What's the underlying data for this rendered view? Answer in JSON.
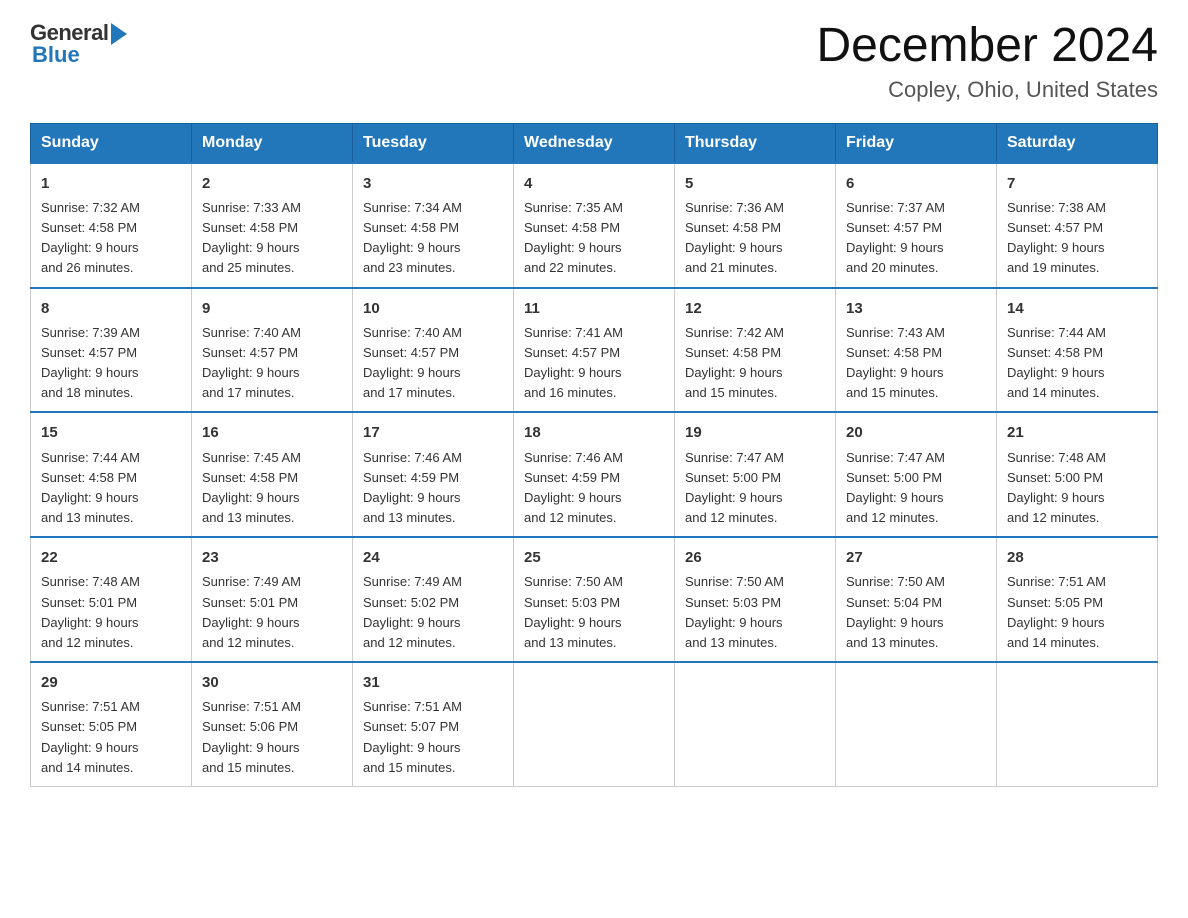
{
  "header": {
    "logo_general": "General",
    "logo_blue": "Blue",
    "title": "December 2024",
    "subtitle": "Copley, Ohio, United States"
  },
  "days_of_week": [
    "Sunday",
    "Monday",
    "Tuesday",
    "Wednesday",
    "Thursday",
    "Friday",
    "Saturday"
  ],
  "weeks": [
    [
      {
        "day": "1",
        "sunrise": "7:32 AM",
        "sunset": "4:58 PM",
        "daylight": "9 hours and 26 minutes."
      },
      {
        "day": "2",
        "sunrise": "7:33 AM",
        "sunset": "4:58 PM",
        "daylight": "9 hours and 25 minutes."
      },
      {
        "day": "3",
        "sunrise": "7:34 AM",
        "sunset": "4:58 PM",
        "daylight": "9 hours and 23 minutes."
      },
      {
        "day": "4",
        "sunrise": "7:35 AM",
        "sunset": "4:58 PM",
        "daylight": "9 hours and 22 minutes."
      },
      {
        "day": "5",
        "sunrise": "7:36 AM",
        "sunset": "4:58 PM",
        "daylight": "9 hours and 21 minutes."
      },
      {
        "day": "6",
        "sunrise": "7:37 AM",
        "sunset": "4:57 PM",
        "daylight": "9 hours and 20 minutes."
      },
      {
        "day": "7",
        "sunrise": "7:38 AM",
        "sunset": "4:57 PM",
        "daylight": "9 hours and 19 minutes."
      }
    ],
    [
      {
        "day": "8",
        "sunrise": "7:39 AM",
        "sunset": "4:57 PM",
        "daylight": "9 hours and 18 minutes."
      },
      {
        "day": "9",
        "sunrise": "7:40 AM",
        "sunset": "4:57 PM",
        "daylight": "9 hours and 17 minutes."
      },
      {
        "day": "10",
        "sunrise": "7:40 AM",
        "sunset": "4:57 PM",
        "daylight": "9 hours and 17 minutes."
      },
      {
        "day": "11",
        "sunrise": "7:41 AM",
        "sunset": "4:57 PM",
        "daylight": "9 hours and 16 minutes."
      },
      {
        "day": "12",
        "sunrise": "7:42 AM",
        "sunset": "4:58 PM",
        "daylight": "9 hours and 15 minutes."
      },
      {
        "day": "13",
        "sunrise": "7:43 AM",
        "sunset": "4:58 PM",
        "daylight": "9 hours and 15 minutes."
      },
      {
        "day": "14",
        "sunrise": "7:44 AM",
        "sunset": "4:58 PM",
        "daylight": "9 hours and 14 minutes."
      }
    ],
    [
      {
        "day": "15",
        "sunrise": "7:44 AM",
        "sunset": "4:58 PM",
        "daylight": "9 hours and 13 minutes."
      },
      {
        "day": "16",
        "sunrise": "7:45 AM",
        "sunset": "4:58 PM",
        "daylight": "9 hours and 13 minutes."
      },
      {
        "day": "17",
        "sunrise": "7:46 AM",
        "sunset": "4:59 PM",
        "daylight": "9 hours and 13 minutes."
      },
      {
        "day": "18",
        "sunrise": "7:46 AM",
        "sunset": "4:59 PM",
        "daylight": "9 hours and 12 minutes."
      },
      {
        "day": "19",
        "sunrise": "7:47 AM",
        "sunset": "5:00 PM",
        "daylight": "9 hours and 12 minutes."
      },
      {
        "day": "20",
        "sunrise": "7:47 AM",
        "sunset": "5:00 PM",
        "daylight": "9 hours and 12 minutes."
      },
      {
        "day": "21",
        "sunrise": "7:48 AM",
        "sunset": "5:00 PM",
        "daylight": "9 hours and 12 minutes."
      }
    ],
    [
      {
        "day": "22",
        "sunrise": "7:48 AM",
        "sunset": "5:01 PM",
        "daylight": "9 hours and 12 minutes."
      },
      {
        "day": "23",
        "sunrise": "7:49 AM",
        "sunset": "5:01 PM",
        "daylight": "9 hours and 12 minutes."
      },
      {
        "day": "24",
        "sunrise": "7:49 AM",
        "sunset": "5:02 PM",
        "daylight": "9 hours and 12 minutes."
      },
      {
        "day": "25",
        "sunrise": "7:50 AM",
        "sunset": "5:03 PM",
        "daylight": "9 hours and 13 minutes."
      },
      {
        "day": "26",
        "sunrise": "7:50 AM",
        "sunset": "5:03 PM",
        "daylight": "9 hours and 13 minutes."
      },
      {
        "day": "27",
        "sunrise": "7:50 AM",
        "sunset": "5:04 PM",
        "daylight": "9 hours and 13 minutes."
      },
      {
        "day": "28",
        "sunrise": "7:51 AM",
        "sunset": "5:05 PM",
        "daylight": "9 hours and 14 minutes."
      }
    ],
    [
      {
        "day": "29",
        "sunrise": "7:51 AM",
        "sunset": "5:05 PM",
        "daylight": "9 hours and 14 minutes."
      },
      {
        "day": "30",
        "sunrise": "7:51 AM",
        "sunset": "5:06 PM",
        "daylight": "9 hours and 15 minutes."
      },
      {
        "day": "31",
        "sunrise": "7:51 AM",
        "sunset": "5:07 PM",
        "daylight": "9 hours and 15 minutes."
      },
      null,
      null,
      null,
      null
    ]
  ]
}
